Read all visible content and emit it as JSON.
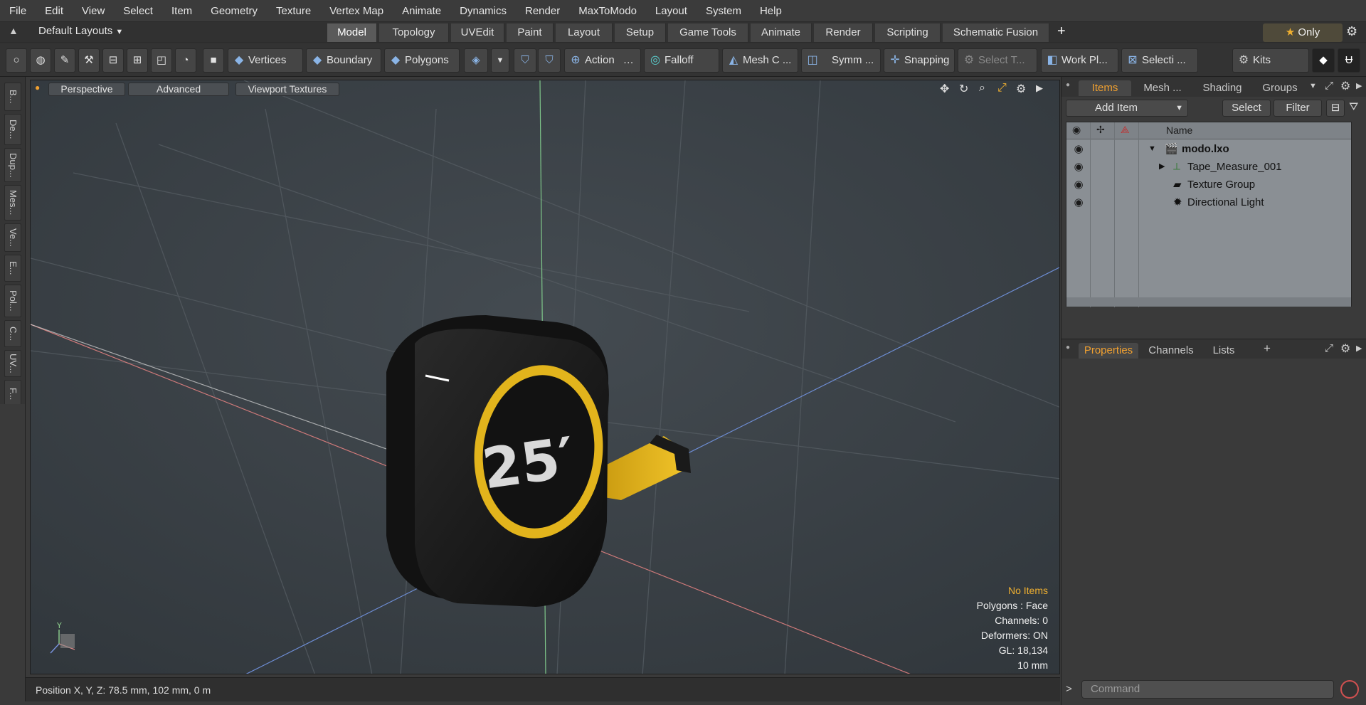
{
  "menubar": {
    "items": [
      "File",
      "Edit",
      "View",
      "Select",
      "Item",
      "Geometry",
      "Texture",
      "Vertex Map",
      "Animate",
      "Dynamics",
      "Render",
      "MaxToModo",
      "Layout",
      "System",
      "Help"
    ]
  },
  "layoutbar": {
    "layout_select": "Default Layouts",
    "tabs": [
      "Model",
      "Topology",
      "UVEdit",
      "Paint",
      "Layout",
      "Setup",
      "Game Tools",
      "Animate",
      "Render",
      "Scripting",
      "Schematic Fusion"
    ],
    "add_label": "+",
    "only_label": "Only"
  },
  "toolbar": {
    "vertices": "Vertices",
    "boundary": "Boundary",
    "polygons": "Polygons",
    "action": "Action",
    "falloff": "Falloff",
    "mesh_c": "Mesh C ...",
    "symm": "Symm ...",
    "snapping": "Snapping",
    "select_t": "Select T...",
    "work_pl": "Work Pl...",
    "selecti": "Selecti ...",
    "kits": "Kits"
  },
  "left_tabs": [
    "B...",
    "De...",
    "Dup...",
    "Mes...",
    "Ve...",
    "E...",
    "Pol...",
    "C...",
    "UV...",
    "F..."
  ],
  "viewport": {
    "mode": "Perspective",
    "shading": "Advanced",
    "textures": "Viewport Textures",
    "label_25": "25′",
    "info": {
      "selection": "No Items",
      "polygons": "Polygons : Face",
      "channels": "Channels: 0",
      "deformers": "Deformers: ON",
      "gl": "GL: 18,134",
      "scale": "10 mm"
    },
    "axis_y": "Y"
  },
  "status": {
    "position": "Position X, Y, Z:   78.5 mm, 102 mm, 0 m"
  },
  "items_panel": {
    "tabs": [
      "Items",
      "Mesh ...",
      "Shading",
      "Groups"
    ],
    "add_item": "Add Item",
    "select": "Select",
    "filter": "Filter",
    "name_header": "Name",
    "tree": [
      {
        "label": "modo.lxo",
        "bold": true
      },
      {
        "label": "Tape_Measure_001",
        "bold": false
      },
      {
        "label": "Texture Group",
        "bold": false
      },
      {
        "label": "Directional Light",
        "bold": false
      }
    ]
  },
  "properties_panel": {
    "tabs": [
      "Properties",
      "Channels",
      "Lists"
    ],
    "add": "+"
  },
  "command": {
    "placeholder": "Command"
  },
  "colors": {
    "accent": "#f0a030",
    "tape_yellow": "#e8b81e",
    "body_black": "#1a1a1a"
  }
}
